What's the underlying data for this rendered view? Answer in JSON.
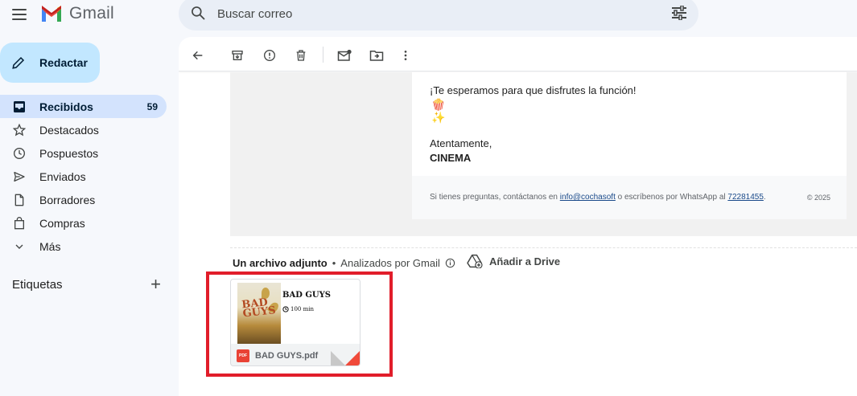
{
  "app": {
    "name": "Gmail"
  },
  "search": {
    "placeholder": "Buscar correo"
  },
  "compose": {
    "label": "Redactar"
  },
  "sidebar": {
    "items": [
      {
        "label": "Recibidos",
        "count": "59",
        "icon": "inbox-icon",
        "active": true
      },
      {
        "label": "Destacados",
        "icon": "star-icon"
      },
      {
        "label": "Pospuestos",
        "icon": "clock-icon"
      },
      {
        "label": "Enviados",
        "icon": "send-icon"
      },
      {
        "label": "Borradores",
        "icon": "draft-icon"
      },
      {
        "label": "Compras",
        "icon": "shopping-bag-icon"
      },
      {
        "label": "Más",
        "icon": "chevron-down-icon"
      }
    ],
    "labels_header": "Etiquetas"
  },
  "toolbar": {
    "icons": [
      "back-arrow-icon",
      "archive-icon",
      "report-spam-icon",
      "delete-icon",
      "mark-unread-icon",
      "move-to-icon",
      "more-vert-icon"
    ]
  },
  "email": {
    "line1": "¡Te esperamos para que disfrutes la función!",
    "emoji1": "🍿",
    "emoji2": "✨",
    "closing": "Atentamente,",
    "signature": "CINEMA",
    "footer_prefix": "Si tienes preguntas, contáctanos en ",
    "footer_email": "info@cochasoft",
    "footer_mid": " o escríbenos por WhatsApp al ",
    "footer_phone": "72281455",
    "footer_suffix": ".",
    "copyright": "© 2025"
  },
  "attachments": {
    "header_bold": "Un archivo adjunto",
    "separator": "•",
    "scanned": "Analizados por Gmail",
    "drive_label": "Añadir a Drive",
    "file": {
      "name": "BAD GUYS.pdf",
      "badge": "PDF",
      "thumb_title": "BAD GUYS",
      "thumb_duration": "100 min",
      "poster_text": "BAD GUYS"
    }
  },
  "colors": {
    "accent": "#c2e7ff",
    "active_nav": "#d3e3fd",
    "highlight_box": "#e11d2a"
  }
}
